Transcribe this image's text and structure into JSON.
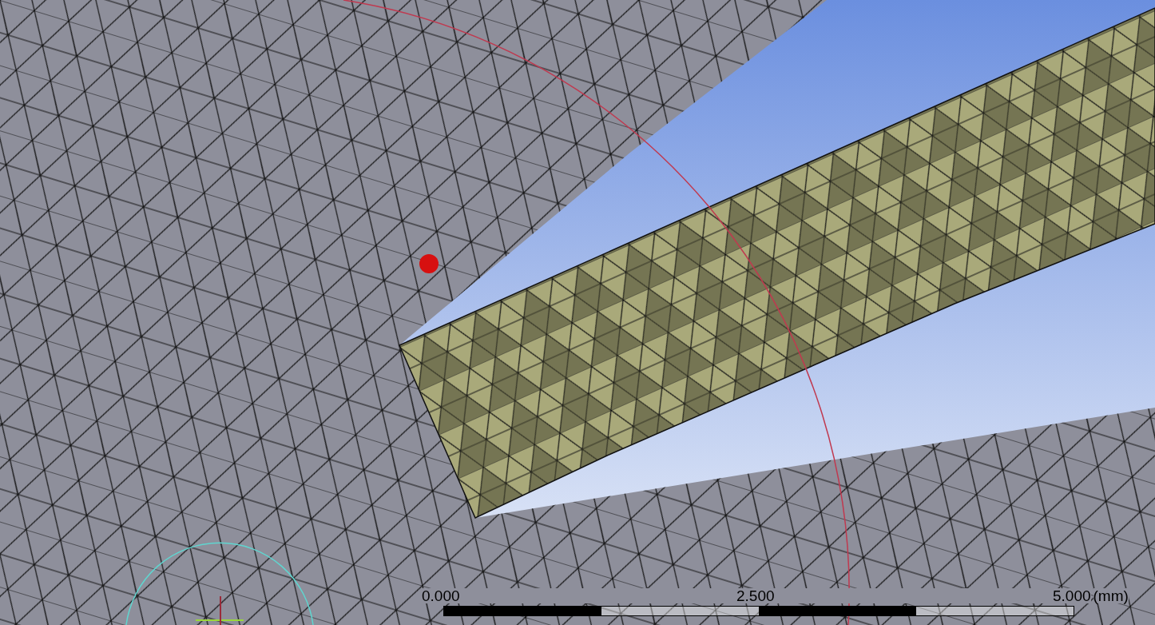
{
  "viewport": {
    "scale_bar": {
      "labels": [
        "0.000",
        "2.500",
        "5.000"
      ],
      "unit": "(mm)"
    }
  }
}
